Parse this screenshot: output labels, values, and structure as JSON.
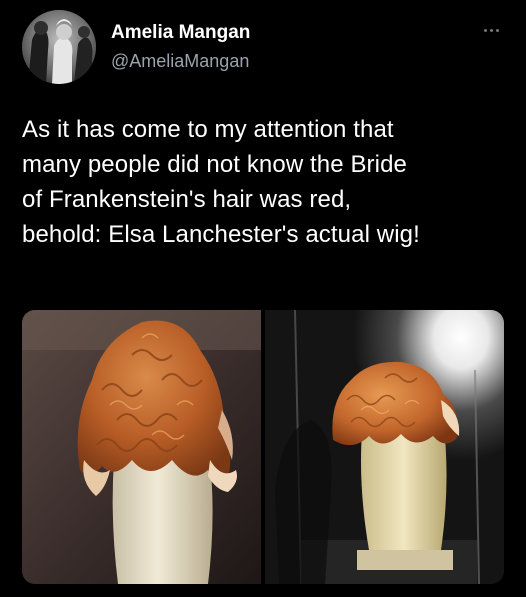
{
  "author": {
    "name": "Amelia Mangan",
    "handle": "@AmeliaMangan"
  },
  "tweet": {
    "text": "As it has come to my attention that\nmany people did not know the Bride\nof Frankenstein's hair was red,\nbehold: Elsa Lanchester's actual wig!"
  },
  "icons": {
    "more": "more-horizontal-icon",
    "avatar": "avatar-photo"
  },
  "colors": {
    "background": "#000000",
    "text": "#ffffff",
    "handle": "#9aa3ab",
    "wig_red": "#c2662c",
    "wig_highlight": "#d8ad8b"
  }
}
